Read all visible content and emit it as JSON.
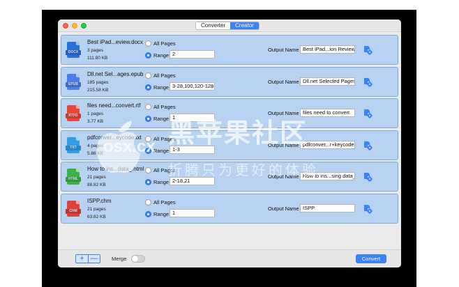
{
  "tabs": [
    {
      "label": "Converter",
      "active": false
    },
    {
      "label": "Creator",
      "active": true
    }
  ],
  "options": {
    "all_pages": "All Pages",
    "range": "Range",
    "output_name": "Output Name"
  },
  "files": [
    {
      "name": "Best iPad...eview.docx",
      "pages": "3 pages",
      "size": "111.80 KB",
      "type": "DOCX",
      "color": "#2b6fd6",
      "range": "2",
      "output": "Best iPad...ion Review"
    },
    {
      "name": "Dll.net Sel...ages.epub",
      "pages": "185 pages",
      "size": "215.58 KB",
      "type": "EPUB",
      "color": "#4d7ee8",
      "range": "3-28,100,120-128",
      "output": "Dll.net Selected Pages"
    },
    {
      "name": "files need...convert.rtf",
      "pages": "1 pages",
      "size": "3.77 KB",
      "type": "RTFD",
      "color": "#e8473c",
      "range": "1",
      "output": "files need to convert"
    },
    {
      "name": "pdfconver...eycode.txt",
      "pages": "4 pages",
      "size": "5.86 KB",
      "type": "TXT",
      "color": "#2f9fe8",
      "range": "1-3",
      "output": "pdfconver...r+keycode"
    },
    {
      "name": "How to ins...data_.html",
      "pages": "21 pages",
      "size": "88.82 KB",
      "type": "HTML",
      "color": "#3db04a",
      "range": "2-18,21",
      "output": "How to ins...sing data_"
    },
    {
      "name": "ISPP.chm",
      "pages": "21 pages",
      "size": "63.82 KB",
      "type": "CHM",
      "color": "#e0403a",
      "range": "1",
      "output": "ISPP"
    }
  ],
  "bottom": {
    "add": "+",
    "remove": "—",
    "merge_label": "Merge",
    "convert_label": "Convert"
  },
  "watermark": {
    "title": "黑苹果社区",
    "site": "osx.cx",
    "subtitle": "折腾只为更好的体验"
  },
  "colors": {
    "accent": "#3c82f6",
    "row_bg": "#b7d3f1",
    "row_border": "#7fa9db"
  }
}
